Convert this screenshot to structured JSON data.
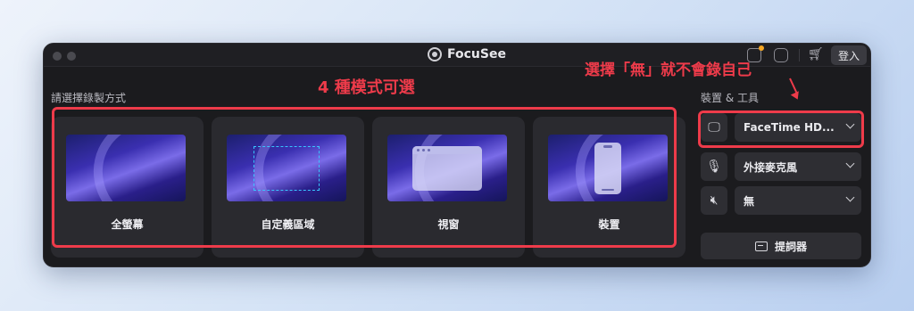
{
  "app": {
    "title": "FocuSee",
    "login_label": "登入"
  },
  "left_section": {
    "label": "請選擇錄製方式"
  },
  "right_section": {
    "label": "裝置 & 工具"
  },
  "modes": [
    {
      "label": "全螢幕"
    },
    {
      "label": "自定義區域"
    },
    {
      "label": "視窗"
    },
    {
      "label": "裝置"
    }
  ],
  "devices": {
    "camera": {
      "value": "FaceTime HD...",
      "icon": "webcam-monitor-icon"
    },
    "microphone": {
      "value": "外接麥克風",
      "icon": "microphone-icon"
    },
    "audio": {
      "value": "無",
      "icon": "speaker-muted-icon"
    }
  },
  "prompter": {
    "label": "提詞器",
    "icon": "teleprompter-icon"
  },
  "annotations": {
    "modes_note": "4 種模式可選",
    "camera_note": "選擇「無」就不會錄自己"
  },
  "colors": {
    "annotation_red": "#ee3b4a",
    "window_bg": "#1b1b1e",
    "card_bg": "#2a2a2f"
  }
}
